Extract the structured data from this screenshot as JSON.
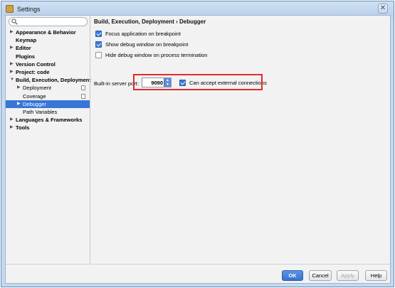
{
  "window": {
    "title": "Settings",
    "close_label": "✕"
  },
  "search": {
    "placeholder": ""
  },
  "sidebar": {
    "items": [
      {
        "label": "Appearance & Behavior",
        "arrow": "▶",
        "bold": true
      },
      {
        "label": "Keymap",
        "arrow": "",
        "bold": true
      },
      {
        "label": "Editor",
        "arrow": "▶",
        "bold": true
      },
      {
        "label": "Plugins",
        "arrow": "",
        "bold": true
      },
      {
        "label": "Version Control",
        "arrow": "▶",
        "bold": true
      },
      {
        "label": "Project: code",
        "arrow": "▶",
        "bold": true
      },
      {
        "label": "Build, Execution, Deployment",
        "arrow": "▼",
        "bold": true
      },
      {
        "label": "Deployment",
        "arrow": "▶",
        "bold": false
      },
      {
        "label": "Coverage",
        "arrow": "",
        "bold": false
      },
      {
        "label": "Debugger",
        "arrow": "▶",
        "bold": false
      },
      {
        "label": "Path Variables",
        "arrow": "",
        "bold": false
      },
      {
        "label": "Languages & Frameworks",
        "arrow": "▶",
        "bold": true
      },
      {
        "label": "Tools",
        "arrow": "▶",
        "bold": true
      }
    ],
    "selected_index": 9
  },
  "main": {
    "breadcrumb": "Build, Execution, Deployment › Debugger",
    "options": [
      {
        "label": "Focus application on breakpoint",
        "checked": true
      },
      {
        "label": "Show debug window on breakpoint",
        "checked": true
      },
      {
        "label": "Hide debug window on process termination",
        "checked": false
      }
    ],
    "port_label": "Built-in server port:",
    "port_value": "9090",
    "external_label": "Can accept external connections",
    "external_checked": true
  },
  "buttons": {
    "ok": "OK",
    "cancel": "Cancel",
    "apply": "Apply",
    "help": "Help"
  },
  "colors": {
    "accent": "#3875d7",
    "highlight_box": "#e02b2b"
  }
}
